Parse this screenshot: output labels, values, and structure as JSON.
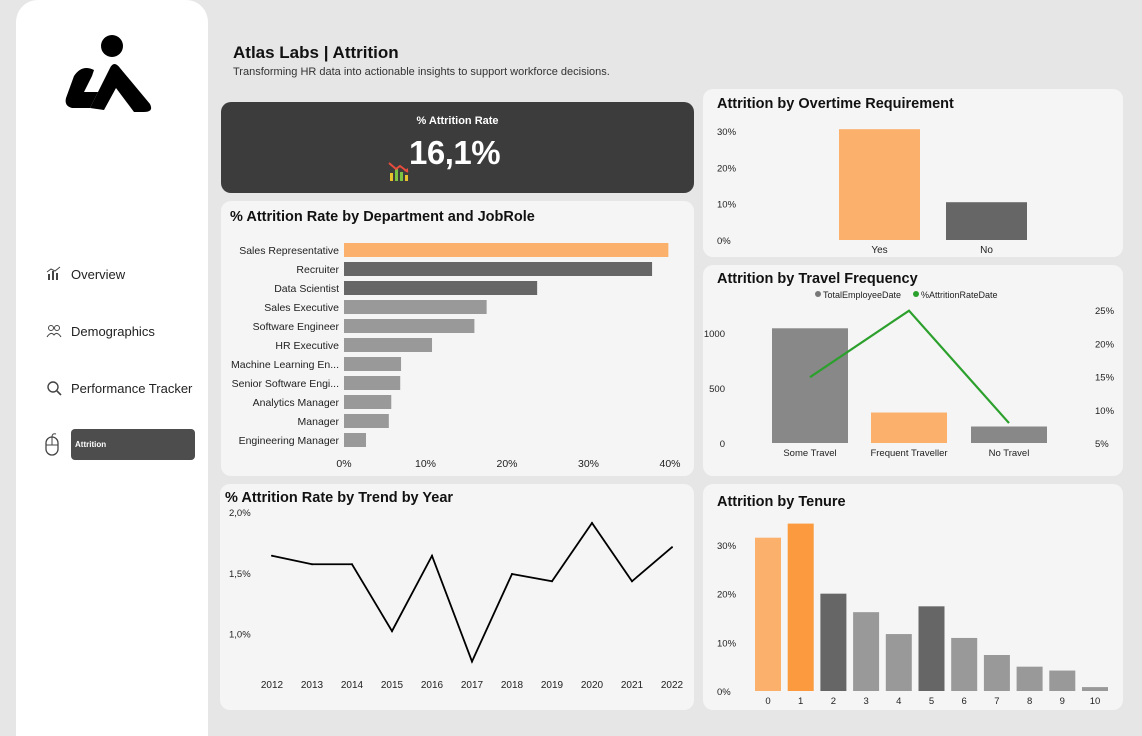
{
  "header": {
    "title": "Atlas Labs | Attrition",
    "subtitle": "Transforming HR data into actionable insights to support workforce decisions."
  },
  "nav": {
    "items": [
      {
        "label": "Overview",
        "icon": "chart-icon"
      },
      {
        "label": "Demographics",
        "icon": "people-icon"
      },
      {
        "label": "Performance Tracker",
        "icon": "search-icon"
      },
      {
        "label": "Attrition",
        "icon": "mouse-icon",
        "active": true
      }
    ]
  },
  "kpi": {
    "label": "% Attrition Rate",
    "value": "16,1%",
    "icon": "trend-down-chart-icon"
  },
  "colors": {
    "orange_light": "#fbb06b",
    "orange": "#fb9a3e",
    "dark_gray": "#666666",
    "mid_gray": "#999999",
    "kpi_bg": "#3c3c3c",
    "green": "#2ca02c"
  },
  "chart_data": [
    {
      "id": "dept_jobrole",
      "type": "bar",
      "orientation": "horizontal",
      "title": "% Attrition Rate by Department and JobRole",
      "categories": [
        "Sales Representative",
        "Recruiter",
        "Data Scientist",
        "Sales Executive",
        "Software Engineer",
        "HR Executive",
        "Machine Learning En...",
        "Senior Software Engi...",
        "Analytics Manager",
        "Manager",
        "Engineering Manager"
      ],
      "values": [
        39.8,
        37.8,
        23.7,
        17.5,
        16.0,
        10.8,
        7.0,
        6.9,
        5.8,
        5.5,
        2.7
      ],
      "x_ticks": [
        "0%",
        "10%",
        "20%",
        "30%",
        "40%"
      ],
      "xlim": [
        0,
        40
      ]
    },
    {
      "id": "trend_year",
      "type": "line",
      "title": "% Attrition Rate by Trend by Year",
      "x": [
        "2012",
        "2013",
        "2014",
        "2015",
        "2016",
        "2017",
        "2018",
        "2019",
        "2020",
        "2021",
        "2022"
      ],
      "values": [
        1.64,
        1.57,
        1.57,
        1.02,
        1.64,
        0.77,
        1.49,
        1.43,
        1.91,
        1.43,
        1.71
      ],
      "y_ticks": [
        "1,0%",
        "1,5%",
        "2,0%"
      ],
      "ylim": [
        0.7,
        2.0
      ]
    },
    {
      "id": "overtime",
      "type": "bar",
      "title": "Attrition by Overtime Requirement",
      "categories": [
        "Yes",
        "No"
      ],
      "values": [
        30.5,
        10.4
      ],
      "y_ticks": [
        "0%",
        "10%",
        "20%",
        "30%"
      ],
      "ylim": [
        0,
        30
      ]
    },
    {
      "id": "travel",
      "type": "bar",
      "title": "Attrition by Travel Frequency",
      "legend": [
        "TotalEmployeeDate",
        "%AttritionRateDate"
      ],
      "legend_position": "top",
      "categories": [
        "Some Travel",
        "Frequent Traveller",
        "No Travel"
      ],
      "series": [
        {
          "name": "TotalEmployeeDate",
          "values": [
            1043,
            277,
            150
          ]
        },
        {
          "name": "%AttritionRateDate",
          "values": [
            14.9,
            24.9,
            8.0
          ]
        }
      ],
      "y_ticks_left": [
        "0",
        "500",
        "1000"
      ],
      "ylim_left": [
        0,
        1000
      ],
      "y_ticks_right": [
        "5%",
        "10%",
        "15%",
        "20%",
        "25%"
      ],
      "ylim_right": [
        5,
        25
      ]
    },
    {
      "id": "tenure",
      "type": "bar",
      "title": "Attrition by Tenure",
      "categories": [
        "0",
        "1",
        "2",
        "3",
        "4",
        "5",
        "6",
        "7",
        "8",
        "9",
        "10"
      ],
      "values": [
        31.5,
        34.4,
        20.0,
        16.2,
        11.7,
        17.4,
        10.9,
        7.4,
        5.0,
        4.2,
        0.8
      ],
      "y_ticks": [
        "0%",
        "10%",
        "20%",
        "30%"
      ],
      "ylim": [
        0,
        30
      ]
    }
  ]
}
